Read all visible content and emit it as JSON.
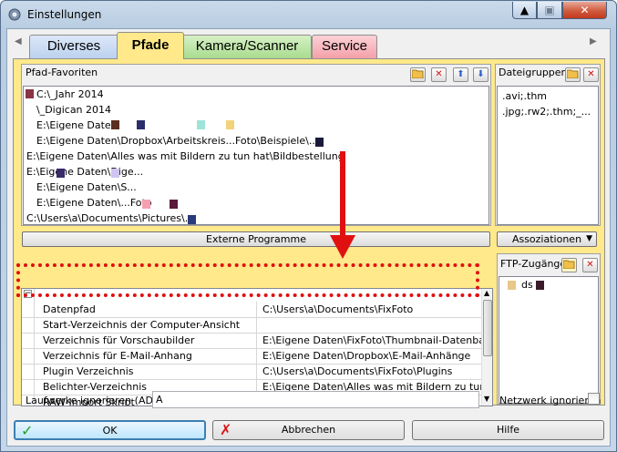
{
  "window": {
    "title": "Einstellungen",
    "min": "▲",
    "max": "▣",
    "close": "✕"
  },
  "tabs": {
    "left_arrow": "◀",
    "right_arrow": "▶",
    "items": [
      "Diverses",
      "Pfade",
      "Kamera/Scanner",
      "Service"
    ]
  },
  "favorites": {
    "title": "Pfad-Favoriten",
    "items": [
      "C:\\_Jahr 2014",
      "\\_Digican 2014",
      "E:\\Eigene Daten",
      "E:\\Eigene Daten\\Dropbox\\Arbeitskreis...Foto\\Beispiele\\...",
      "E:\\Eigene Daten\\Alles was mit Bildern zu tun hat\\Bildbestellung",
      "E:\\Eigene Daten\\Dige...",
      "E:\\Eigene Daten\\S...",
      "E:\\Eigene Daten\\...Foto",
      "C:\\Users\\a\\Documents\\Pictures\\..."
    ]
  },
  "filegroups": {
    "title": "Dateigruppen",
    "items": [
      ".avi;.thm",
      ".jpg;.rw2;.thm;_..."
    ]
  },
  "buttons": {
    "external": "Externe Programme",
    "associations": "Assoziationen",
    "ok": "OK",
    "cancel": "Abbrechen",
    "help": "Hilfe"
  },
  "ftp": {
    "title": "FTP-Zugänge",
    "items": [
      "ds"
    ]
  },
  "grid": {
    "rows": [
      {
        "name": "Datenpfad",
        "value": "C:\\Users\\a\\Documents\\FixFoto"
      },
      {
        "name": "Start-Verzeichnis der Computer-Ansicht",
        "value": ""
      },
      {
        "name": "Verzeichnis für Vorschaubilder",
        "value": "E:\\Eigene Daten\\FixFoto\\Thumbnail-Datenbank"
      },
      {
        "name": "Verzeichnis für E-Mail-Anhang",
        "value": "E:\\Eigene Daten\\Dropbox\\E-Mail-Anhänge"
      },
      {
        "name": "Plugin Verzeichnis",
        "value": "C:\\Users\\a\\Documents\\FixFoto\\Plugins"
      },
      {
        "name": "Belichter-Verzeichnis",
        "value": "E:\\Eigene Daten\\Alles was mit Bildern zu tun h..."
      },
      {
        "name": "RAW-Import Skript",
        "value": ""
      }
    ]
  },
  "drives": {
    "label": "Laufwerke ignorieren (AD...)",
    "value": "A"
  },
  "network": {
    "label": "Netzwerk ignorieren"
  },
  "colors": {
    "highlight": "#e01010",
    "tab_active": "#ffe98a"
  }
}
